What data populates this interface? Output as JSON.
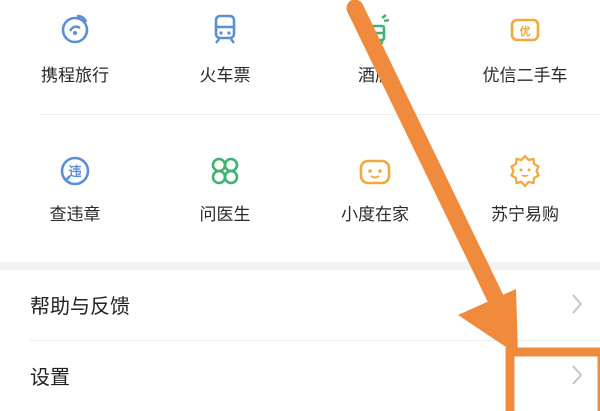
{
  "services": {
    "row1": [
      {
        "label": "携程旅行",
        "icon": "ctrip-icon",
        "color": "#5a8fd6"
      },
      {
        "label": "火车票",
        "icon": "train-icon",
        "color": "#5a8fd6"
      },
      {
        "label": "酒店",
        "icon": "hotel-icon",
        "color": "#3cb371"
      },
      {
        "label": "优信二手车",
        "icon": "used-car-icon",
        "color": "#f0a93a"
      }
    ],
    "row2": [
      {
        "label": "查违章",
        "icon": "violation-icon",
        "color": "#5a8fd6"
      },
      {
        "label": "问医生",
        "icon": "doctor-icon",
        "color": "#3cb371"
      },
      {
        "label": "小度在家",
        "icon": "xiaodu-icon",
        "color": "#f0a93a"
      },
      {
        "label": "苏宁易购",
        "icon": "suning-icon",
        "color": "#f0a93a"
      }
    ]
  },
  "menu": {
    "help_label": "帮助与反馈",
    "settings_label": "设置"
  },
  "annotation": {
    "color": "#f08b3d"
  }
}
